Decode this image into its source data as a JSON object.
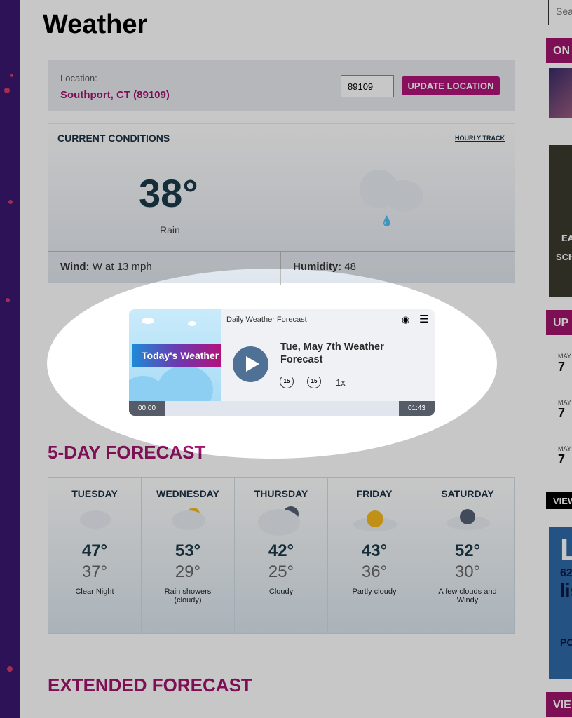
{
  "page": {
    "title": "Weather"
  },
  "location": {
    "label": "Location:",
    "value": "Southport, CT (89109)",
    "zip": "89109",
    "button": "UPDATE LOCATION"
  },
  "current": {
    "title": "CURRENT CONDITIONS",
    "hourly_link": "HOURLY TRACK",
    "temp": "38°",
    "condition": "Rain",
    "wind_label": "Wind:",
    "wind": "W at 13 mph",
    "humidity_label": "Humidity:",
    "humidity": "48",
    "icon": "rain-cloud-icon"
  },
  "player": {
    "show": "Daily Weather Forecast",
    "art_text": "Today's Weather",
    "episode": "Tue, May 7th Weather Forecast",
    "skip_back": "15",
    "skip_forward": "15",
    "speed": "1x",
    "elapsed": "00:00",
    "duration": "01:43",
    "progress": 0
  },
  "forecast": {
    "title": "5-DAY FORECAST",
    "days": [
      {
        "name": "TUESDAY",
        "hi": "47°",
        "lo": "37°",
        "cond": "Clear Night"
      },
      {
        "name": "WEDNESDAY",
        "hi": "53°",
        "lo": "29°",
        "cond": "Rain showers (cloudy)"
      },
      {
        "name": "THURSDAY",
        "hi": "42°",
        "lo": "25°",
        "cond": "Cloudy"
      },
      {
        "name": "FRIDAY",
        "hi": "43°",
        "lo": "36°",
        "cond": "Partly cloudy"
      },
      {
        "name": "SATURDAY",
        "hi": "52°",
        "lo": "30°",
        "cond": "A few clouds and Windy"
      }
    ]
  },
  "extended": {
    "title": "EXTENDED FORECAST"
  },
  "sidebar": {
    "search_placeholder": "Sea",
    "on": "ON",
    "ad1": [
      "EA",
      "SCH"
    ],
    "up": "UP",
    "events": [
      {
        "month": "MAY",
        "day": "7"
      },
      {
        "month": "MAY",
        "day": "7"
      },
      {
        "month": "MAY",
        "day": "7"
      }
    ],
    "view": "VIEW",
    "ad2": [
      "L",
      "62",
      "lis",
      "PO"
    ],
    "vie": "VIE"
  }
}
